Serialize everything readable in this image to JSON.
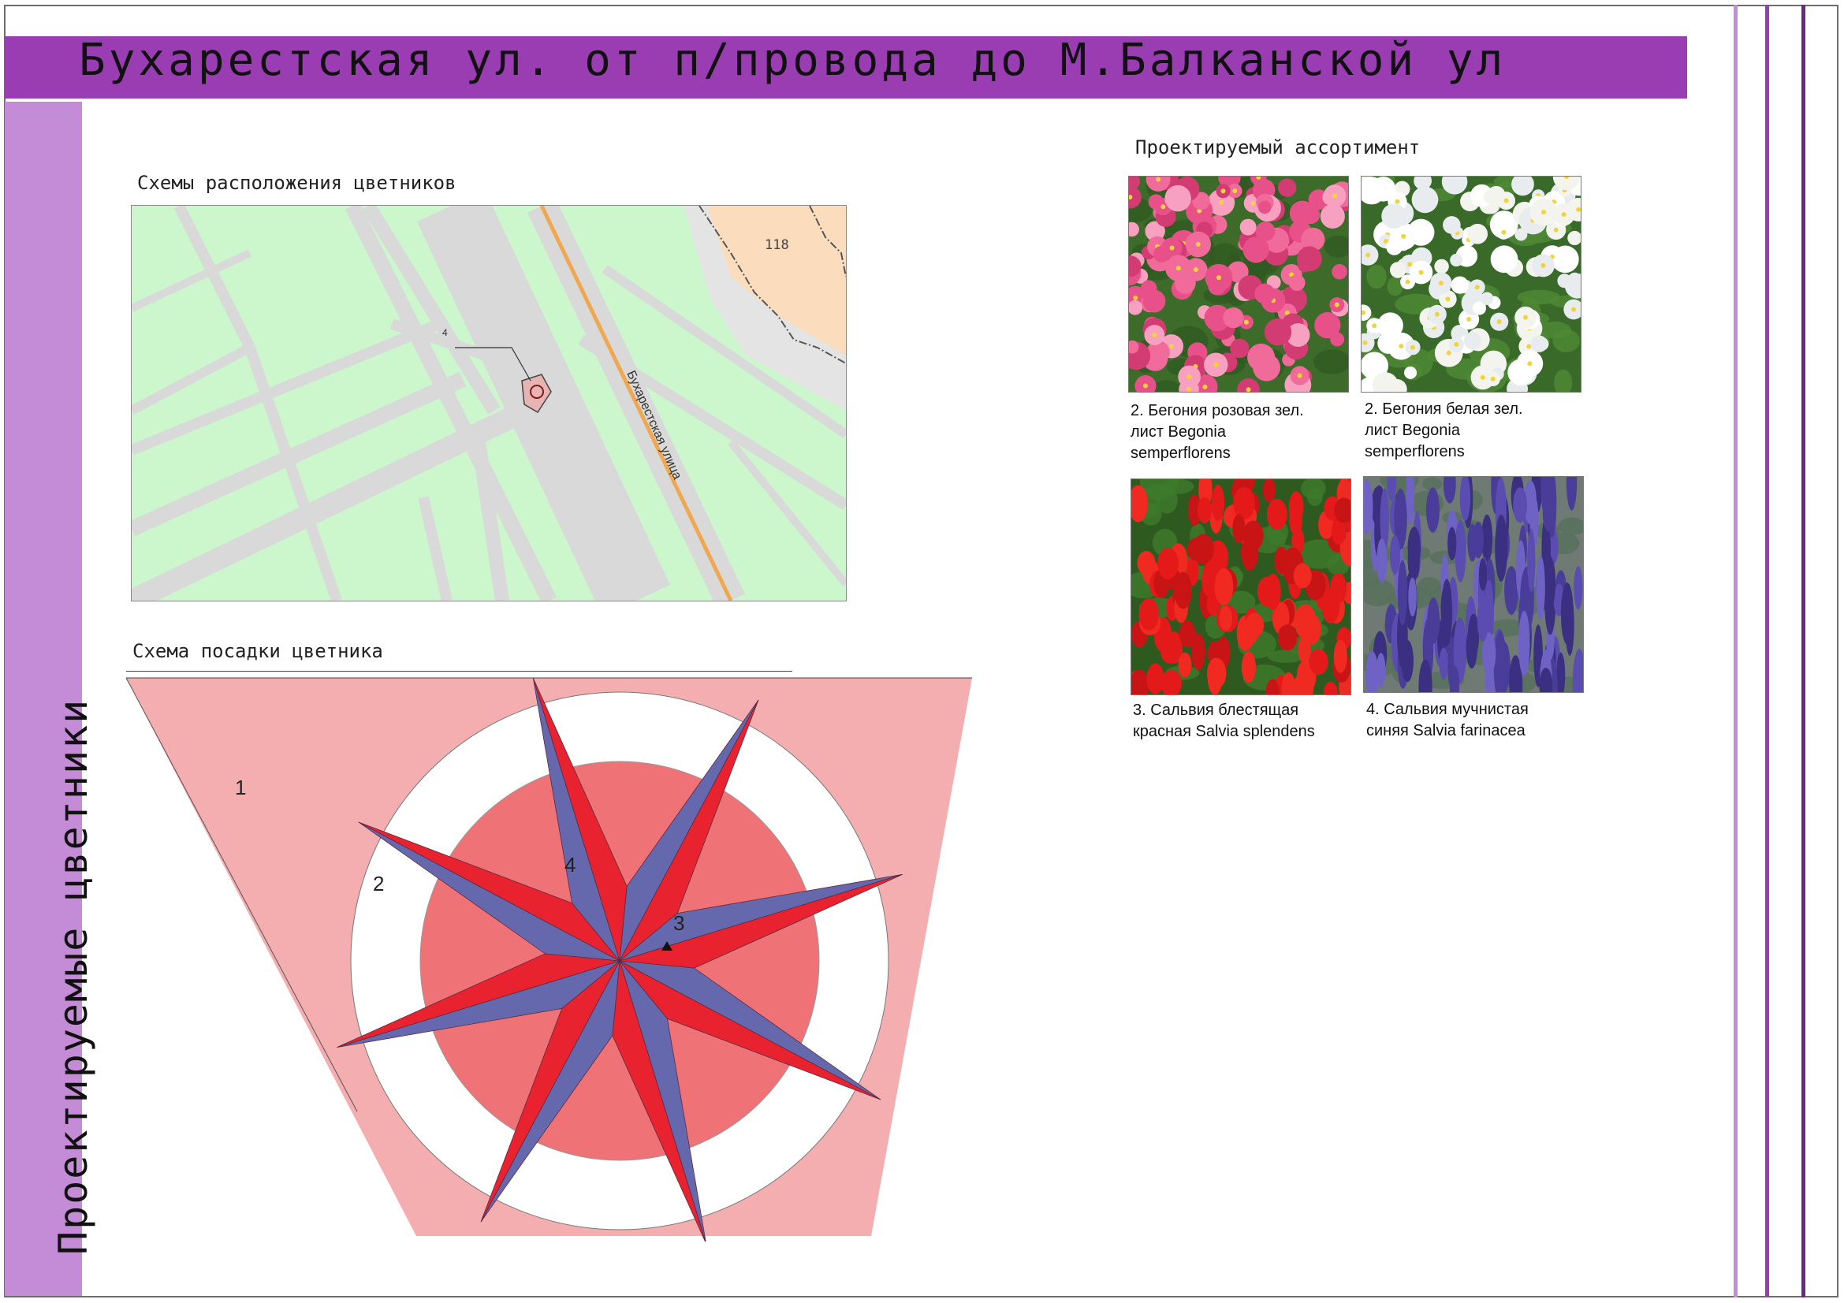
{
  "header": {
    "title": "Бухарестская ул. от п/провода до М.Балканской ул"
  },
  "sidebar": {
    "label": "Проектируемые цветники"
  },
  "sections": {
    "location_scheme": "Схемы расположения цветников",
    "planting_scheme": "Схема посадки цветника",
    "assortment": "Проектируемый ассортимент"
  },
  "map": {
    "building_number": "118",
    "street_name": "Бухарестская улица",
    "marker_number": "4"
  },
  "planting": {
    "zone_labels": [
      "1",
      "2",
      "3",
      "4"
    ]
  },
  "assortment_items": [
    {
      "lines": [
        "2. Бегония розовая зел.",
        "лист Begonia",
        "semperflorens"
      ]
    },
    {
      "lines": [
        "2. Бегония белая зел.",
        "лист Begonia",
        "semperflorens"
      ]
    },
    {
      "lines": [
        "3. Сальвия блестящая",
        "красная Salvia splendens"
      ]
    },
    {
      "lines": [
        "4. Сальвия мучнистая",
        "синяя  Salvia farinacea"
      ]
    }
  ],
  "colors": {
    "title_bar": "#9a3db3",
    "side_band": "#c48bd6",
    "zone1": "#f4aeb0",
    "zone2": "#ffffff",
    "inner_circle": "#ef7376",
    "star_red": "#e8232f",
    "star_blue": "#6568ac",
    "map_green": "#ccf6cc",
    "map_road": "#d9d9d9",
    "map_building": "#fbdcbc"
  }
}
